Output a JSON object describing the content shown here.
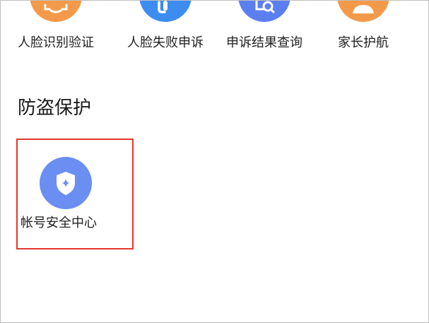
{
  "top_row": {
    "items": [
      {
        "label": "人脸识别验证",
        "icon": "face-scan-icon",
        "color": "#f39a4a"
      },
      {
        "label": "人脸失败申诉",
        "icon": "headset-icon",
        "color": "#3d8cf0"
      },
      {
        "label": "申诉结果查询",
        "icon": "document-search-icon",
        "color": "#5b7ff0"
      },
      {
        "label": "家长护航",
        "icon": "parent-icon",
        "color": "#f39a4a"
      }
    ]
  },
  "section": {
    "title": "防盗保护"
  },
  "account_security": {
    "label": "帐号安全中心",
    "icon": "shield-star-icon",
    "color": "#6b8ef2"
  },
  "highlight": {
    "color": "#e2362f"
  }
}
